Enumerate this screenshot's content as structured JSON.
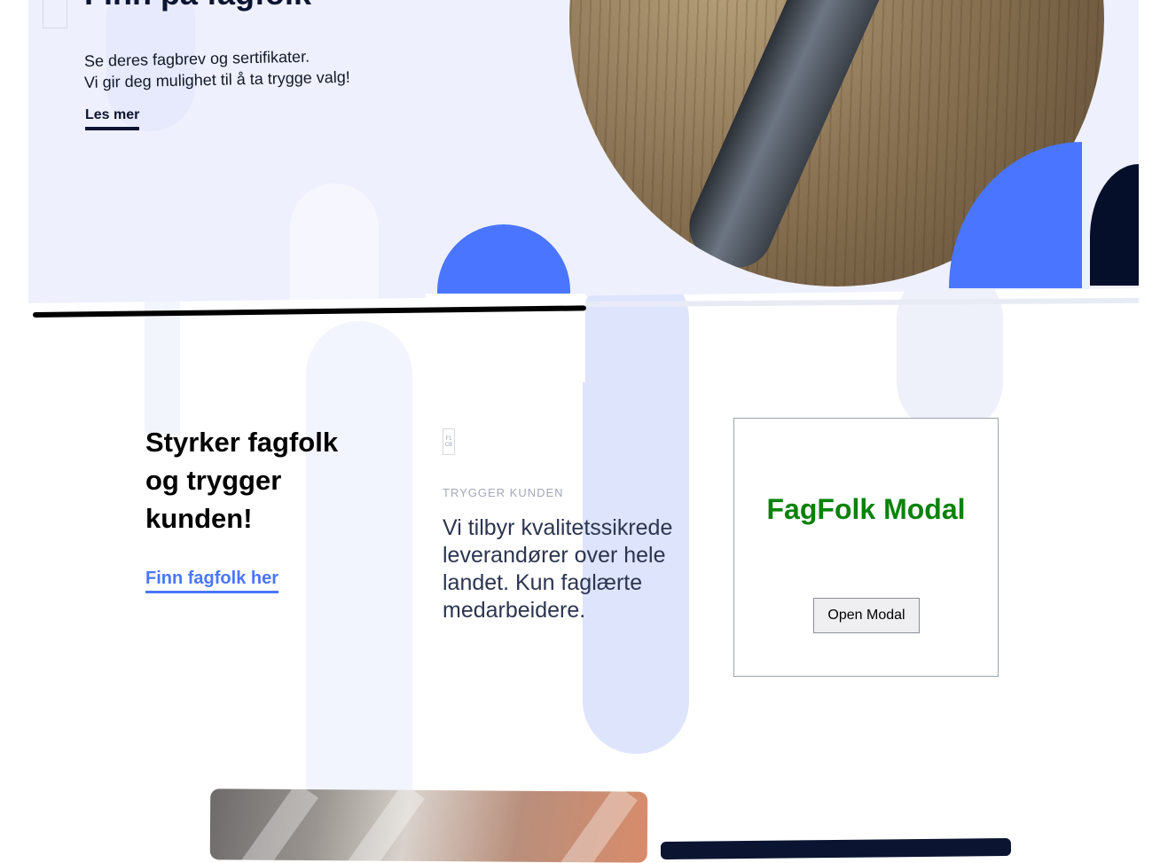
{
  "hero": {
    "title": "Finn på fagfolk",
    "line1": "Se deres fagbrev og sertifikater.",
    "line2": "Vi gir deg mulighet til å ta trygge valg!",
    "link_label": "Les mer"
  },
  "intro": {
    "heading": "Styrker fagfolk og trygger kunden!",
    "link_label": "Finn fagfolk her"
  },
  "feature": {
    "logo_text": "F1 CB",
    "eyebrow": "TRYGGER KUNDEN",
    "text": "Vi tilbyr kvalitetssikrede leverandører over hele landet. Kun faglærte medarbeidere."
  },
  "modal_card": {
    "title": "FagFolk Modal",
    "button_label": "Open Modal"
  },
  "colors": {
    "accent_blue": "#4a76ff",
    "navy": "#0b1430",
    "modal_green": "#0a820a",
    "hero_bg": "#eef0fe"
  }
}
